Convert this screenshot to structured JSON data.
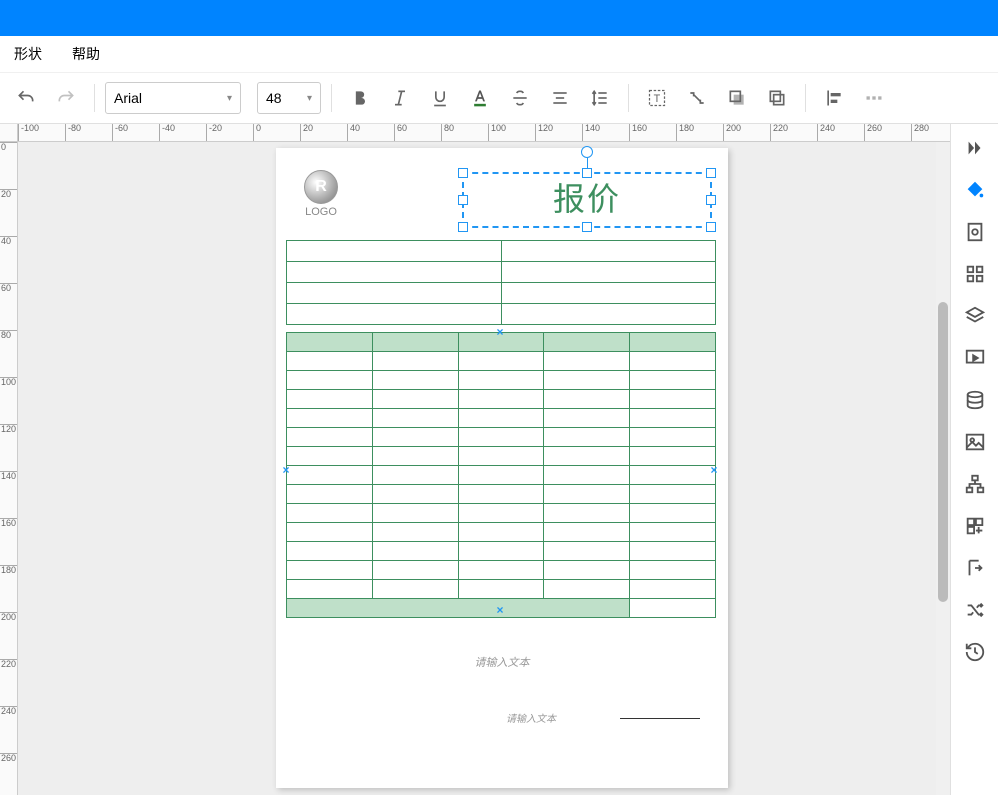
{
  "menubar": {
    "shape": "形状",
    "help": "帮助"
  },
  "toolbar": {
    "font_family": "Arial",
    "font_size": "48"
  },
  "document": {
    "logo_label": "LOGO",
    "title": "报价",
    "placeholder_main": "请输入文本",
    "placeholder_sig": "请输入文本"
  },
  "ruler": {
    "h": [
      "-100",
      "-80",
      "-60",
      "-40",
      "-20",
      "0",
      "20",
      "40",
      "60",
      "80",
      "100",
      "120",
      "140",
      "160",
      "180",
      "200",
      "220",
      "240",
      "260",
      "280"
    ],
    "v": [
      "0",
      "20",
      "40",
      "60",
      "80",
      "100",
      "120",
      "140",
      "160",
      "180",
      "200",
      "220",
      "240",
      "260"
    ]
  },
  "info_table": {
    "rows": 4,
    "cols": 2
  },
  "main_table": {
    "header_cols": 5,
    "body_rows": 13,
    "footer_cols": [
      4,
      1
    ]
  }
}
